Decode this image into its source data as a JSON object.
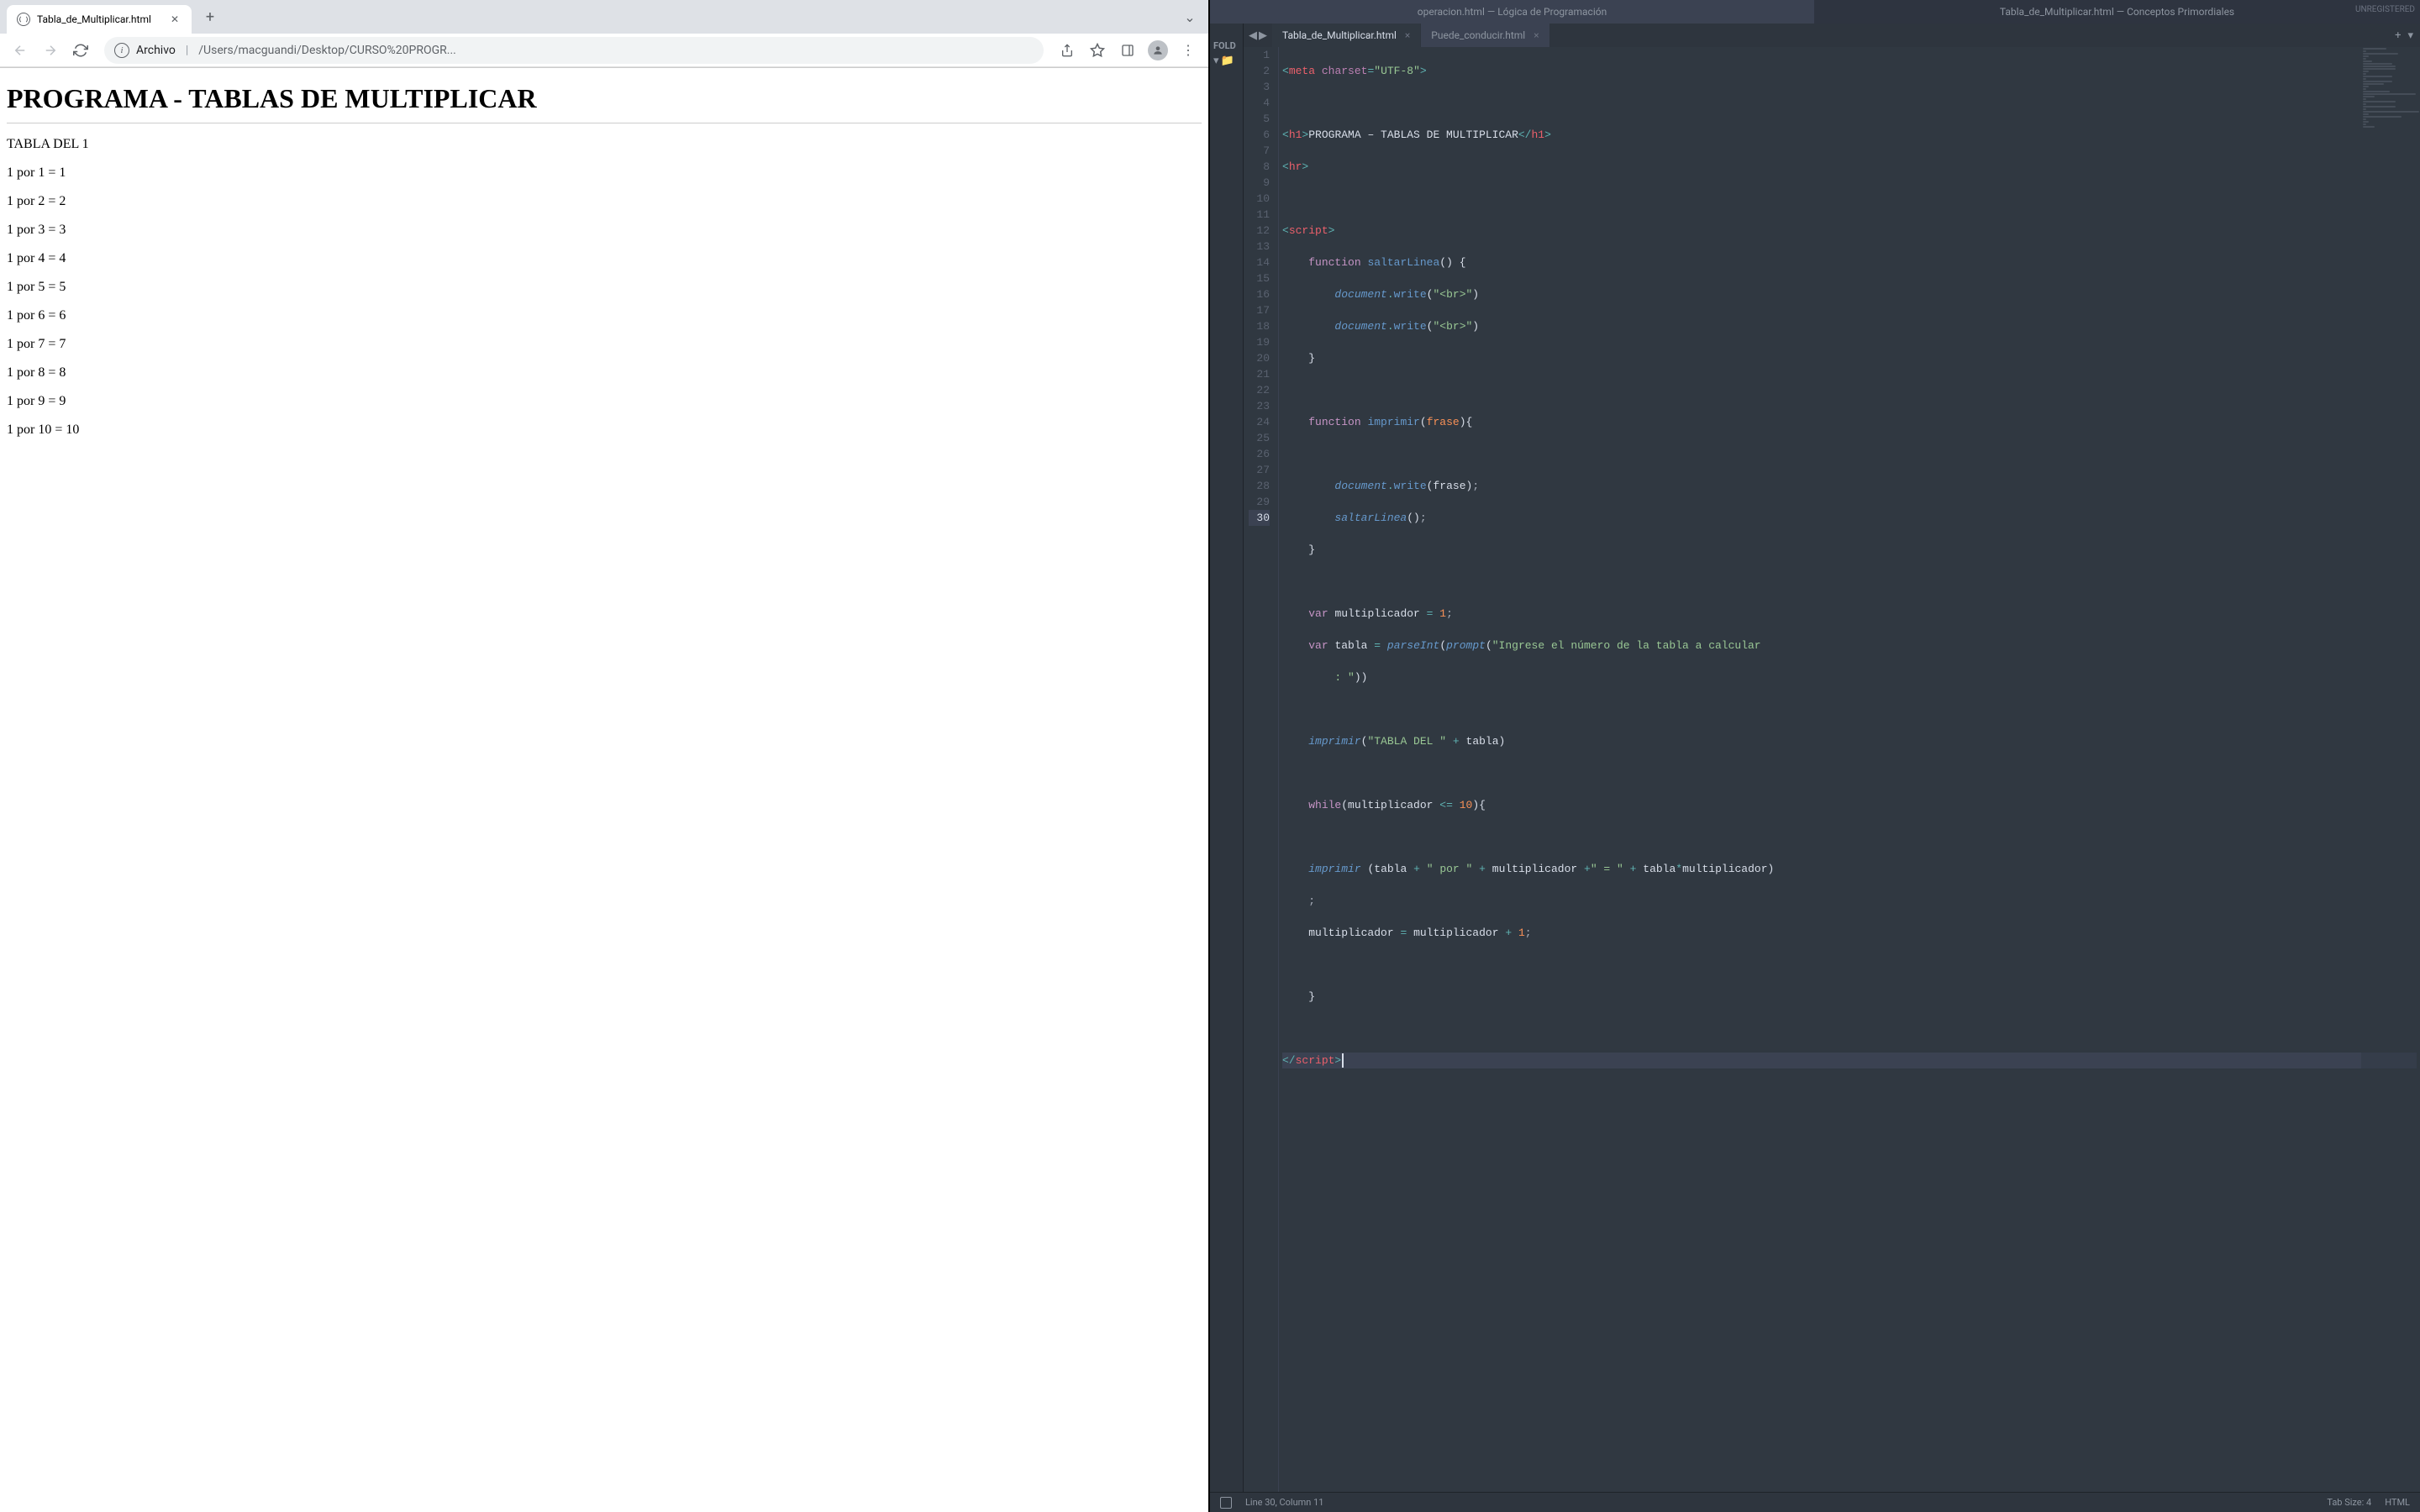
{
  "browser": {
    "tab_title": "Tabla_de_Multiplicar.html",
    "url_scheme": "Archivo",
    "url_path": "/Users/macguandi/Desktop/CURSO%20PROGR...",
    "page": {
      "h1": "PROGRAMA - TABLAS DE MULTIPLICAR",
      "table_header": "TABLA DEL 1",
      "lines": [
        "1 por 1 = 1",
        "1 por 2 = 2",
        "1 por 3 = 3",
        "1 por 4 = 4",
        "1 por 5 = 5",
        "1 por 6 = 6",
        "1 por 7 = 7",
        "1 por 8 = 8",
        "1 por 9 = 9",
        "1 por 10 = 10"
      ]
    }
  },
  "editor": {
    "unregistered": "UNREGISTERED",
    "project_tabs": [
      "operacion.html — Lógica de Programación",
      "Tabla_de_Multiplicar.html — Conceptos Primordiales"
    ],
    "sidebar_label": "FOLD",
    "file_tabs": [
      {
        "name": "Tabla_de_Multiplicar.html",
        "active": true
      },
      {
        "name": "Puede_conducir.html",
        "active": false
      }
    ],
    "line_numbers": [
      "1",
      "2",
      "3",
      "4",
      "5",
      "6",
      "7",
      "8",
      "9",
      "10",
      "11",
      "12",
      "13",
      "14",
      "15",
      "16",
      "17",
      "18",
      "19",
      "20",
      "21",
      "22",
      "23",
      "24",
      "25",
      "26",
      "27",
      "28",
      "29",
      "30"
    ],
    "active_line": 30,
    "status": {
      "position": "Line 30, Column 11",
      "tab_size": "Tab Size: 4",
      "syntax": "HTML"
    }
  },
  "code": {
    "l1_meta": "meta",
    "l1_charset": "charset",
    "l1_utf": "\"UTF-8\"",
    "l3_h1": "h1",
    "l3_text": "PROGRAMA – TABLAS DE MULTIPLICAR",
    "l4_hr": "hr",
    "l6_script": "script",
    "l7_function": "function",
    "l7_name": "saltarLinea",
    "l8_document": "document",
    "l8_write": "write",
    "l8_br": "\"<br>\"",
    "l9_document": "document",
    "l9_write": "write",
    "l9_br": "\"<br>\"",
    "l12_function": "function",
    "l12_name": "imprimir",
    "l12_param": "frase",
    "l14_document": "document",
    "l14_write": "write",
    "l14_arg": "frase",
    "l15_call": "saltarLinea",
    "l18_var": "var",
    "l18_name": "multiplicador",
    "l18_val": "1",
    "l19_var": "var",
    "l19_name": "tabla",
    "l19_parseInt": "parseInt",
    "l19_prompt": "prompt",
    "l19_msg": "\"Ingrese el número de la tabla a calcular",
    "l19b_msg": ": \"",
    "l21_imprimir": "imprimir",
    "l21_str": "\"TABLA DEL \"",
    "l21_tabla": "tabla",
    "l23_while": "while",
    "l23_mult": "multiplicador",
    "l23_ten": "10",
    "l25_imprimir": "imprimir",
    "l25_tabla": "tabla",
    "l25_por": "\" por \"",
    "l25_mult": "multiplicador",
    "l25_eq": "\" = \"",
    "l25_tabla2": "tabla",
    "l25_mult2": "multiplicador",
    "l26_mult": "multiplicador",
    "l26_mult2": "multiplicador",
    "l26_one": "1",
    "l30_script": "script"
  }
}
